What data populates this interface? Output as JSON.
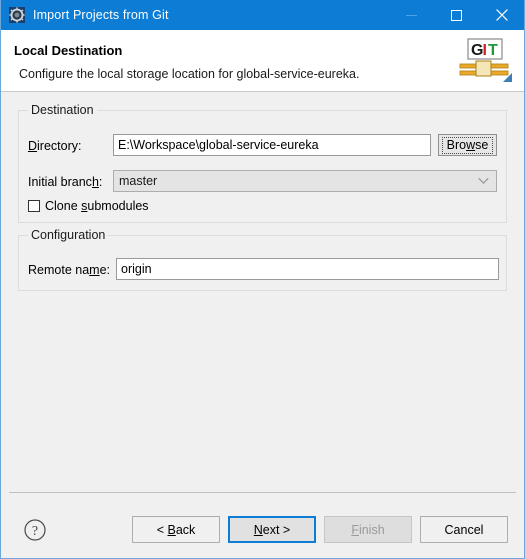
{
  "window": {
    "title": "Import Projects from Git",
    "icon": "eclipse-wizard-gear-icon",
    "controls": {
      "minimize": "minimize-icon",
      "maximize": "maximize-icon",
      "close": "close-icon"
    },
    "accent_color": "#0c7cd5"
  },
  "header": {
    "title": "Local Destination",
    "subtitle": "Configure the local storage location for global-service-eureka.",
    "logo": {
      "name": "git-logo",
      "letters": [
        "G",
        "I",
        "T"
      ],
      "letter_colors": [
        "#1a1a1a",
        "#cc2222",
        "#1f9a3a"
      ],
      "band_color": "#e8a92b"
    }
  },
  "destination": {
    "group_label": "Destination",
    "directory": {
      "label": "Directory:",
      "mnemonic": "D",
      "value": "E:\\Workspace\\global-service-eureka",
      "placeholder": ""
    },
    "browse": {
      "label": "Browse",
      "mnemonic": "w"
    },
    "initial_branch": {
      "label": "Initial branch:",
      "mnemonic": "h",
      "value": "master",
      "options": [
        "master"
      ],
      "arrow_icon": "chevron-down-icon"
    },
    "clone_submodules": {
      "label": "Clone submodules",
      "mnemonic": "s",
      "checked": false
    }
  },
  "configuration": {
    "group_label": "Configuration",
    "remote_name": {
      "label": "Remote name:",
      "mnemonic": "m",
      "value": "origin",
      "placeholder": ""
    }
  },
  "footer": {
    "help_icon": "help-question-icon",
    "buttons": [
      {
        "label": "< Back",
        "state": "enabled",
        "mnemonic": "B"
      },
      {
        "label": "Next >",
        "state": "default",
        "mnemonic": "N"
      },
      {
        "label": "Finish",
        "state": "disabled",
        "mnemonic": "F"
      },
      {
        "label": "Cancel",
        "state": "enabled",
        "mnemonic": ""
      }
    ]
  }
}
